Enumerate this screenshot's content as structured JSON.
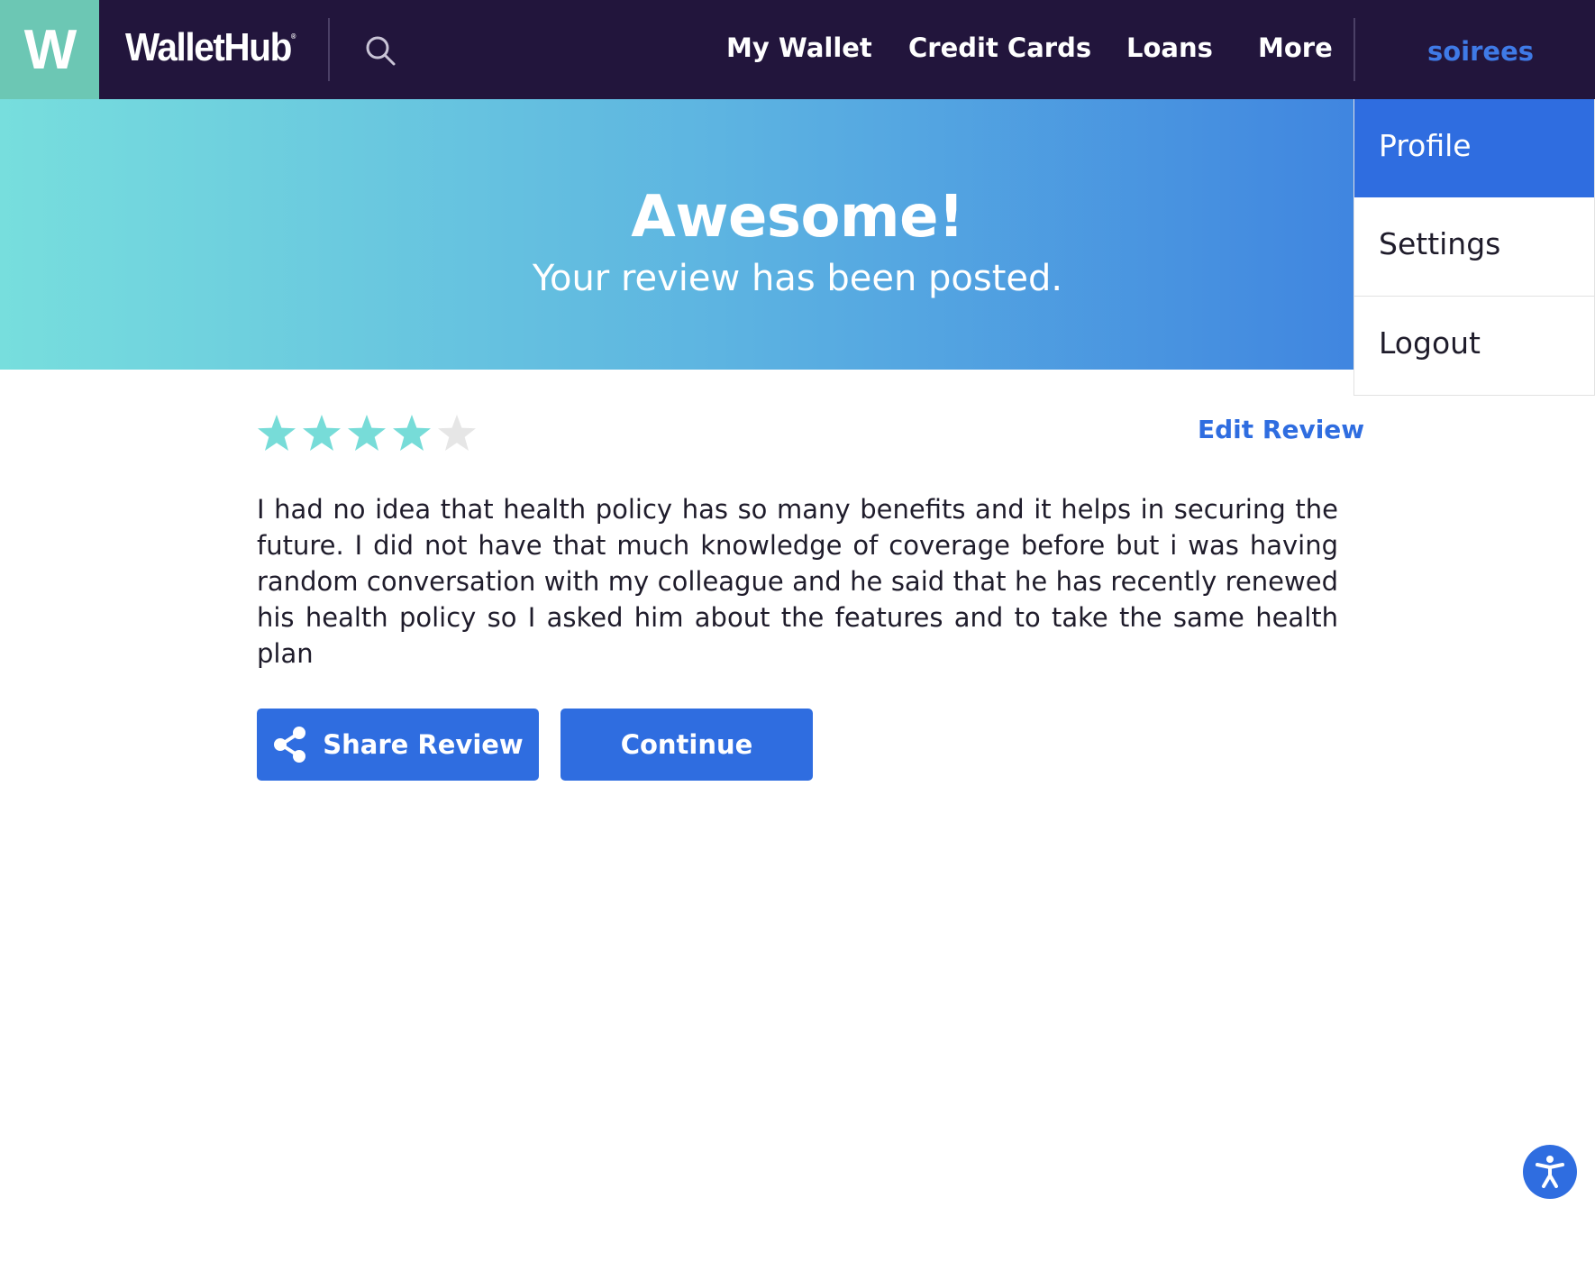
{
  "header": {
    "logo_mark": "W",
    "logo_text": "WalletHub",
    "logo_trademark": "®",
    "nav": [
      {
        "label": "My Wallet"
      },
      {
        "label": "Credit Cards"
      },
      {
        "label": "Loans"
      },
      {
        "label": "More"
      }
    ],
    "user": "soirees",
    "search_icon": "search-icon"
  },
  "hero": {
    "title": "Awesome!",
    "subtitle": "Your review has been posted."
  },
  "user_menu": {
    "items": [
      {
        "label": "Profile",
        "active": true
      },
      {
        "label": "Settings",
        "active": false
      },
      {
        "label": "Logout",
        "active": false
      }
    ]
  },
  "review": {
    "rating": 4,
    "max_rating": 5,
    "edit_label": "Edit Review",
    "text": "I had no idea that health policy has so many benefits and it helps in securing the future. I did not have that much knowledge of coverage before but i was having random conversation with my colleague and he said that he has recently renewed his health policy so I asked him about the features and to take the same health plan"
  },
  "actions": {
    "share_label": "Share Review",
    "continue_label": "Continue"
  },
  "colors": {
    "nav_bg": "#22153c",
    "logo_bg": "#6cc7b4",
    "accent": "#2f6de0",
    "star_filled": "#77dcd8",
    "star_empty": "#e6e6e6"
  },
  "icons": {
    "share": "share-icon",
    "accessibility": "accessibility-icon"
  }
}
